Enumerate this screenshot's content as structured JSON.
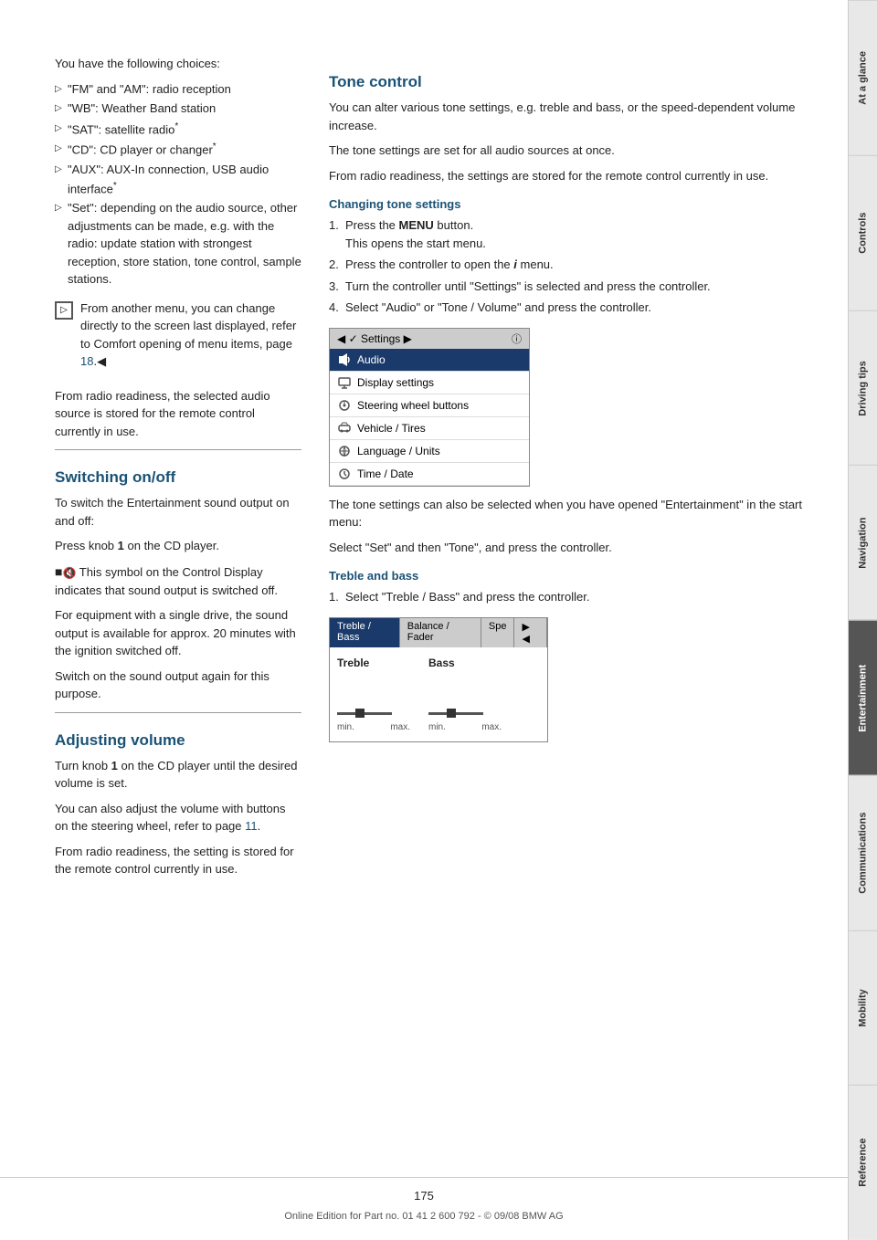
{
  "page": {
    "number": "175",
    "footer": "Online Edition for Part no. 01 41 2 600 792 - © 09/08 BMW AG"
  },
  "sidebar": {
    "tabs": [
      {
        "id": "at-a-glance",
        "label": "At a glance",
        "active": false
      },
      {
        "id": "controls",
        "label": "Controls",
        "active": false
      },
      {
        "id": "driving-tips",
        "label": "Driving tips",
        "active": false
      },
      {
        "id": "navigation",
        "label": "Navigation",
        "active": false
      },
      {
        "id": "entertainment",
        "label": "Entertainment",
        "active": true
      },
      {
        "id": "communications",
        "label": "Communications",
        "active": false
      },
      {
        "id": "mobility",
        "label": "Mobility",
        "active": false
      },
      {
        "id": "reference",
        "label": "Reference",
        "active": false
      }
    ]
  },
  "left_column": {
    "intro": "You have the following choices:",
    "choices": [
      "\"FM\" and \"AM\": radio reception",
      "\"WB\": Weather Band station",
      "\"SAT\": satellite radio*",
      "\"CD\": CD player or changer*",
      "\"AUX\": AUX-In connection, USB audio interface*",
      "\"Set\": depending on the audio source, other adjustments can be made, e.g. with the radio: update station with strongest reception, store station, tone control, sample stations."
    ],
    "note": "From another menu, you can change directly to the screen last displayed, refer to Comfort opening of menu items, page 18.",
    "from_radio": "From radio readiness, the selected audio source is stored for the remote control currently in use.",
    "switching_title": "Switching on/off",
    "switching_body1": "To switch the Entertainment sound output on and off:",
    "switching_body2": "Press knob 1 on the CD player.",
    "switching_symbol": "This symbol on the Control Display indicates that sound output is switched off.",
    "switching_body3": "For equipment with a single drive, the sound output is available for approx. 20 minutes with the ignition switched off.",
    "switching_body4": "Switch on the sound output again for this purpose.",
    "adjusting_title": "Adjusting volume",
    "adjusting_body1": "Turn knob 1 on the CD player until the desired volume is set.",
    "adjusting_body2": "You can also adjust the volume with buttons on the steering wheel, refer to page 11.",
    "adjusting_body3": "From radio readiness, the setting is stored for the remote control currently in use."
  },
  "right_column": {
    "tone_title": "Tone control",
    "tone_intro1": "You can alter various tone settings, e.g. treble and bass, or the speed-dependent volume increase.",
    "tone_intro2": "The tone settings are set for all audio sources at once.",
    "tone_intro3": "From radio readiness, the settings are stored for the remote control currently in use.",
    "changing_tone_title": "Changing tone settings",
    "steps": [
      {
        "number": 1,
        "text": "Press the MENU button.",
        "sub": "This opens the start menu."
      },
      {
        "number": 2,
        "text": "Press the controller to open the i menu."
      },
      {
        "number": 3,
        "text": "Turn the controller until \"Settings\" is selected and press the controller."
      },
      {
        "number": 4,
        "text": "Select \"Audio\" or \"Tone / Volume\" and press the controller."
      }
    ],
    "settings_menu": {
      "header": "Settings",
      "items": [
        {
          "label": "Audio",
          "highlighted": true,
          "icon": "audio"
        },
        {
          "label": "Display settings",
          "highlighted": false,
          "icon": "display"
        },
        {
          "label": "Steering wheel buttons",
          "highlighted": false,
          "icon": "steering"
        },
        {
          "label": "Vehicle / Tires",
          "highlighted": false,
          "icon": "vehicle"
        },
        {
          "label": "Language / Units",
          "highlighted": false,
          "icon": "language"
        },
        {
          "label": "Time / Date",
          "highlighted": false,
          "icon": "time"
        }
      ]
    },
    "after_menu1": "The tone settings can also be selected when you have opened \"Entertainment\" in the start menu:",
    "after_menu2": "Select \"Set\" and then \"Tone\", and press the controller.",
    "treble_bass_title": "Treble and bass",
    "treble_bass_step1": "Select \"Treble / Bass\" and press the controller.",
    "tone_panel": {
      "tabs": [
        "Treble / Bass",
        "Balance / Fader",
        "Spe",
        ""
      ],
      "controls": [
        {
          "label": "Treble",
          "min": "min.",
          "max": "max."
        },
        {
          "label": "Bass",
          "min": "min.",
          "max": "max."
        }
      ]
    }
  }
}
